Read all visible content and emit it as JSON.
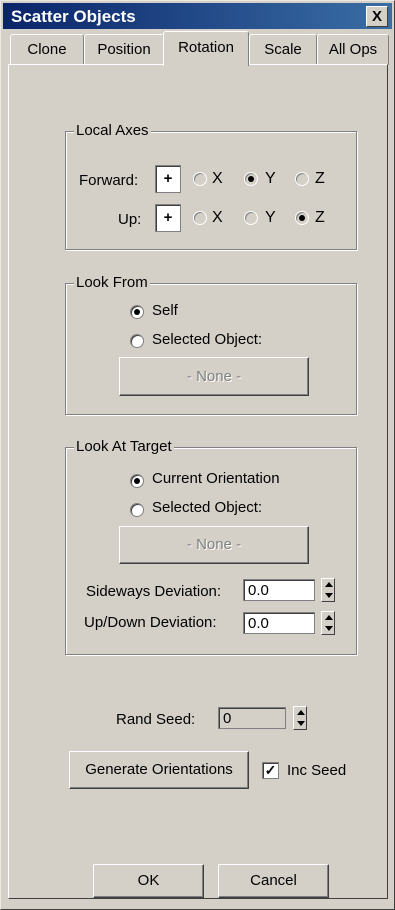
{
  "window": {
    "title": "Scatter Objects",
    "close_label": "X"
  },
  "tabs": [
    {
      "label": "Clone",
      "active": false
    },
    {
      "label": "Position",
      "active": false
    },
    {
      "label": "Rotation",
      "active": true
    },
    {
      "label": "Scale",
      "active": false
    },
    {
      "label": "All Ops",
      "active": false
    }
  ],
  "local_axes": {
    "label": "Local Axes",
    "forward": {
      "label": "Forward:",
      "sign": "+",
      "options": [
        "X",
        "Y",
        "Z"
      ],
      "selected": "Y"
    },
    "up": {
      "label": "Up:",
      "sign": "+",
      "options": [
        "X",
        "Y",
        "Z"
      ],
      "selected": "Z"
    }
  },
  "look_from": {
    "label": "Look From",
    "options": [
      "Self",
      "Selected Object:"
    ],
    "selected": "Self",
    "object_button": "- None -"
  },
  "look_at": {
    "label": "Look At Target",
    "options": [
      "Current Orientation",
      "Selected Object:"
    ],
    "selected": "Current Orientation",
    "object_button": "- None -",
    "sideways_label": "Sideways Deviation:",
    "sideways_value": "0.0",
    "updown_label": "Up/Down Deviation:",
    "updown_value": "0.0"
  },
  "rand_seed": {
    "label": "Rand Seed:",
    "value": "0"
  },
  "generate_button": "Generate Orientations",
  "inc_seed": {
    "label": "Inc Seed",
    "checked": true
  },
  "ok_button": "OK",
  "cancel_button": "Cancel"
}
